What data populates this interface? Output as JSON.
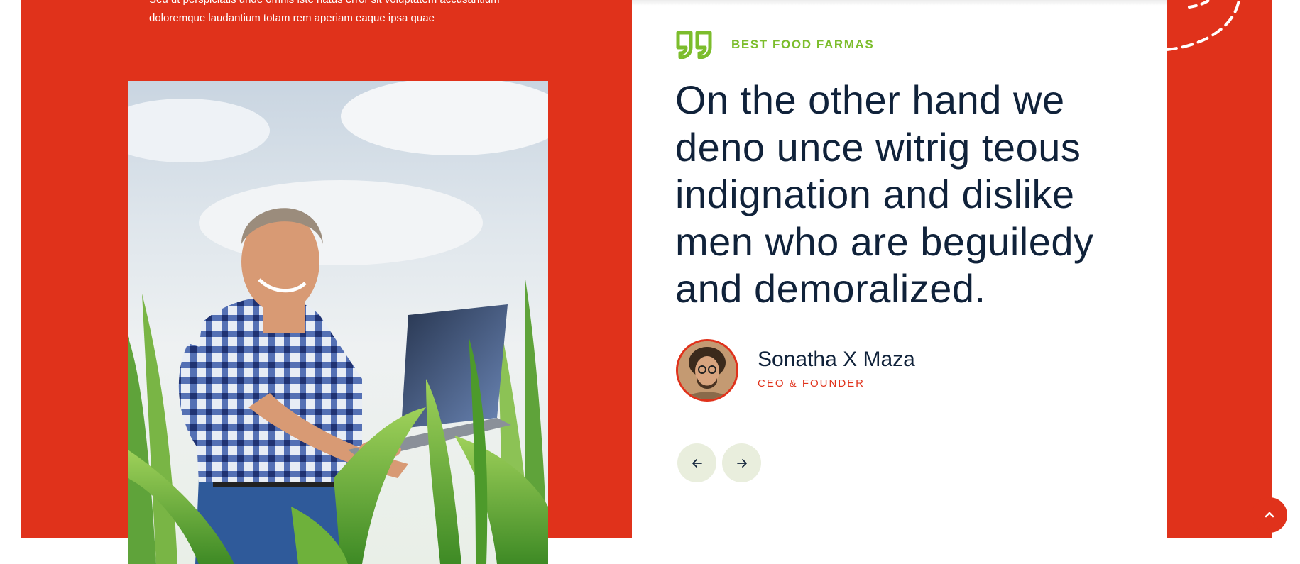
{
  "intro": {
    "line1": "Sed ut perspiciatis unde omnis iste natus error sit voluptatem accusantium",
    "line2": "doloremque laudantium totam rem aperiam eaque ipsa quae"
  },
  "testimonial": {
    "eyebrow": "BEST FOOD FARMAS",
    "quote": "On the other hand we deno unce witrig teous indignation and dislike men who are beguiledy and demoralized.",
    "author_name": "Sonatha X Maza",
    "author_role": "CEO & FOUNDER"
  },
  "icons": {
    "quote": "quote-icon",
    "prev": "arrow-left-icon",
    "next": "arrow-right-icon",
    "scroll_top": "chevron-up-icon"
  },
  "colors": {
    "brand_red": "#e0321b",
    "accent_green": "#7cbd2c",
    "heading_navy": "#10223a",
    "nav_button_bg": "#e9eedd"
  }
}
